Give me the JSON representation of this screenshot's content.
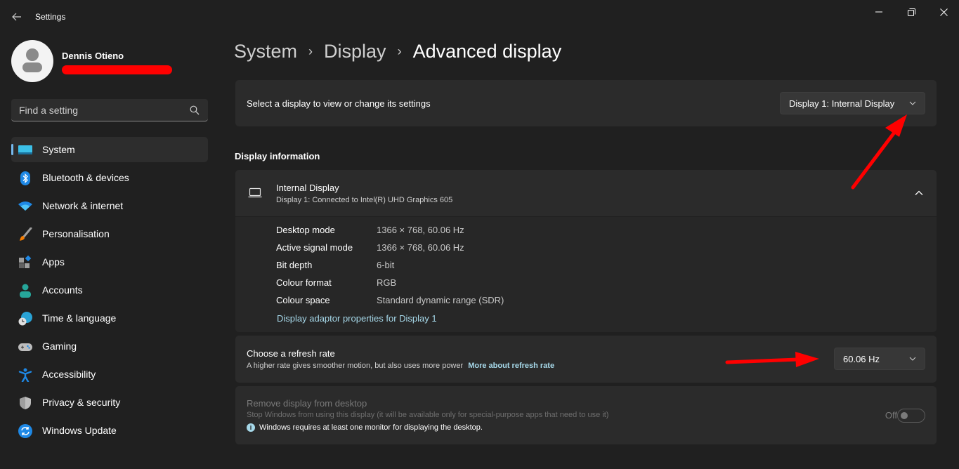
{
  "window": {
    "app_title": "Settings",
    "back_label": "Back",
    "minimize_label": "Minimize",
    "maximize_label": "Restore",
    "close_label": "Close"
  },
  "profile": {
    "name": "Dennis Otieno",
    "email_redacted": true
  },
  "search": {
    "placeholder": "Find a setting",
    "value": ""
  },
  "sidebar": {
    "items": [
      {
        "label": "System",
        "icon": "system-monitor-icon",
        "active": true
      },
      {
        "label": "Bluetooth & devices",
        "icon": "bluetooth-icon",
        "active": false
      },
      {
        "label": "Network & internet",
        "icon": "wifi-icon",
        "active": false
      },
      {
        "label": "Personalisation",
        "icon": "paintbrush-icon",
        "active": false
      },
      {
        "label": "Apps",
        "icon": "apps-icon",
        "active": false
      },
      {
        "label": "Accounts",
        "icon": "account-icon",
        "active": false
      },
      {
        "label": "Time & language",
        "icon": "globe-clock-icon",
        "active": false
      },
      {
        "label": "Gaming",
        "icon": "gamepad-icon",
        "active": false
      },
      {
        "label": "Accessibility",
        "icon": "accessibility-icon",
        "active": false
      },
      {
        "label": "Privacy & security",
        "icon": "shield-icon",
        "active": false
      },
      {
        "label": "Windows Update",
        "icon": "update-icon",
        "active": false
      }
    ],
    "accent_color": "#76b9ed"
  },
  "breadcrumb": {
    "items": [
      "System",
      "Display",
      "Advanced display"
    ],
    "separator": "›"
  },
  "select_display": {
    "label": "Select a display to view or change its settings",
    "selected": "Display 1: Internal Display"
  },
  "display_info": {
    "section_title": "Display information",
    "display_name": "Internal Display",
    "display_subtitle": "Display 1: Connected to Intel(R) UHD Graphics 605",
    "expanded": true,
    "rows": [
      {
        "key": "Desktop mode",
        "value": "1366 × 768, 60.06 Hz"
      },
      {
        "key": "Active signal mode",
        "value": "1366 × 768, 60.06 Hz"
      },
      {
        "key": "Bit depth",
        "value": "6-bit"
      },
      {
        "key": "Colour format",
        "value": "RGB"
      },
      {
        "key": "Colour space",
        "value": "Standard dynamic range (SDR)"
      }
    ],
    "adaptor_link": "Display adaptor properties for Display 1"
  },
  "refresh_rate": {
    "title": "Choose a refresh rate",
    "description": "A higher rate gives smoother motion, but also uses more power",
    "link": "More about refresh rate",
    "selected": "60.06 Hz"
  },
  "remove_display": {
    "title": "Remove display from desktop",
    "description": "Stop Windows from using this display (it will be available only for special-purpose apps that need to use it)",
    "note": "Windows requires at least one monitor for displaying the desktop.",
    "toggle_label": "Off",
    "toggle_on": false,
    "disabled": true
  },
  "annotations": {
    "arrow_color": "#ff0000"
  }
}
